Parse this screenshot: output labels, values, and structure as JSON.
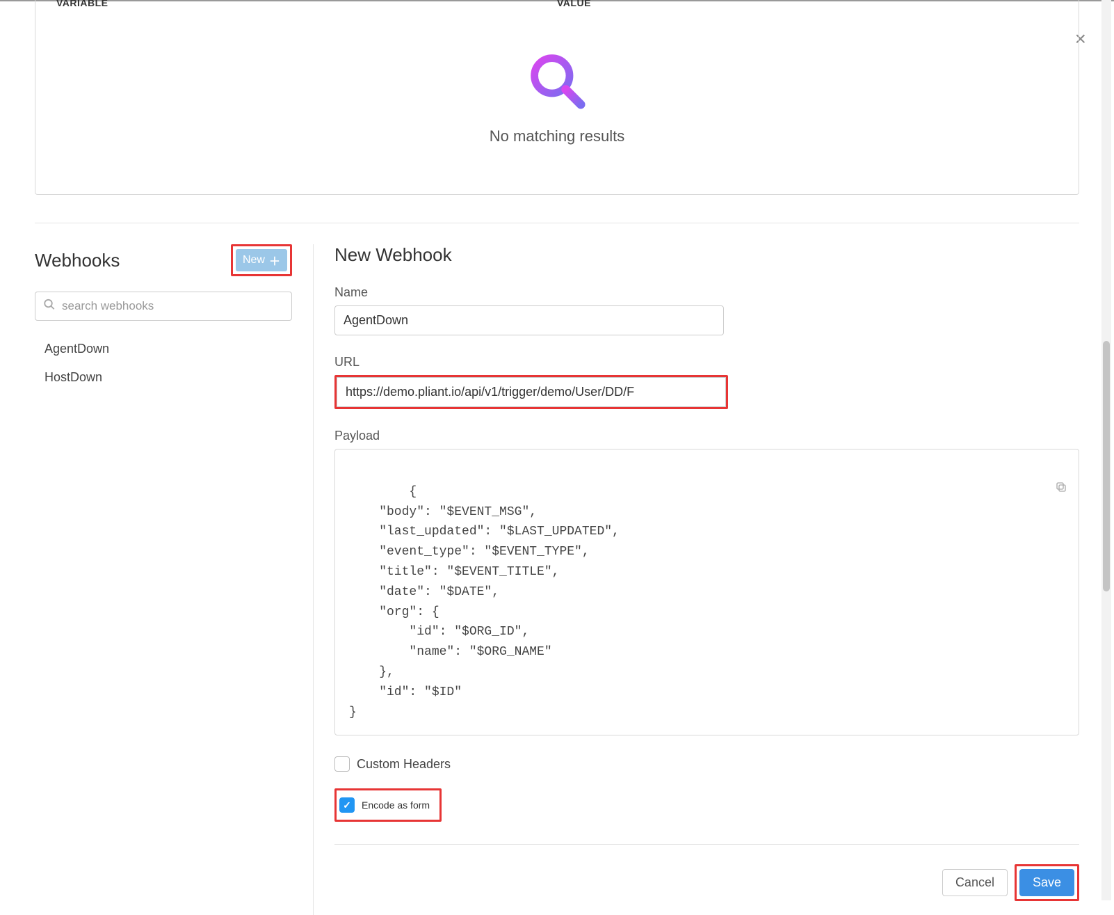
{
  "top": {
    "col_variable": "VARIABLE",
    "col_value": "VALUE",
    "no_results": "No matching results"
  },
  "close_icon": "×",
  "sidebar": {
    "title": "Webhooks",
    "new_button": "New",
    "search_placeholder": "search webhooks",
    "items": [
      {
        "label": "AgentDown"
      },
      {
        "label": "HostDown"
      }
    ]
  },
  "form": {
    "title": "New Webhook",
    "name_label": "Name",
    "name_value": "AgentDown",
    "url_label": "URL",
    "url_value": "https://demo.pliant.io/api/v1/trigger/demo/User/DD/F",
    "payload_label": "Payload",
    "payload_value": "{\n    \"body\": \"$EVENT_MSG\",\n    \"last_updated\": \"$LAST_UPDATED\",\n    \"event_type\": \"$EVENT_TYPE\",\n    \"title\": \"$EVENT_TITLE\",\n    \"date\": \"$DATE\",\n    \"org\": {\n        \"id\": \"$ORG_ID\",\n        \"name\": \"$ORG_NAME\"\n    },\n    \"id\": \"$ID\"\n}",
    "custom_headers_label": "Custom Headers",
    "custom_headers_checked": false,
    "encode_label": "Encode as form",
    "encode_checked": true,
    "cancel": "Cancel",
    "save": "Save"
  },
  "highlights": {
    "new_button": true,
    "url_input": true,
    "encode_checkbox": true,
    "save_button": true,
    "highlight_color": "#e73535"
  },
  "icons": {
    "search": "search-icon",
    "plus": "plus-icon",
    "copy": "copy-icon",
    "check": "✓"
  }
}
